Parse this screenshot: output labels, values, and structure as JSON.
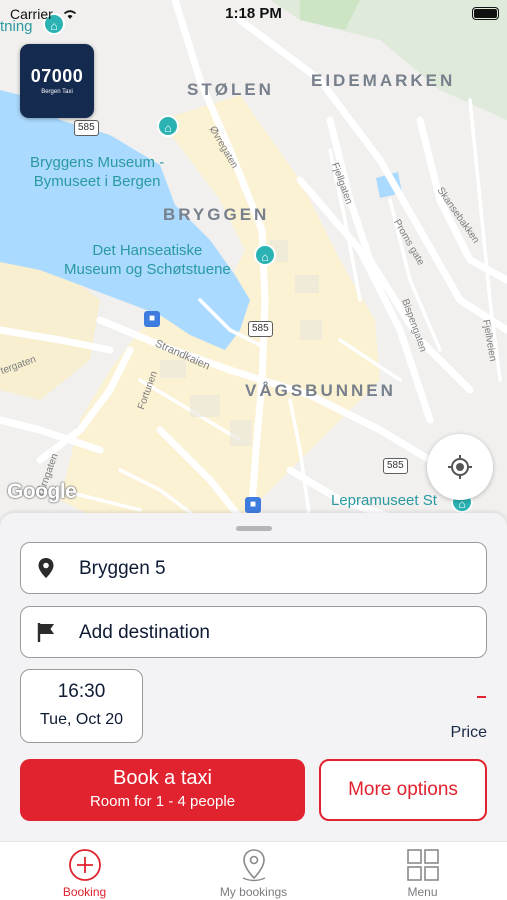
{
  "status_bar": {
    "carrier": "Carrier",
    "time": "1:18 PM"
  },
  "logo": {
    "number": "07000",
    "subtitle": "Bergen Taxi"
  },
  "map": {
    "districts": [
      "STØLEN",
      "EIDEMARKEN",
      "BRYGGEN",
      "VÅGSBUNNEN"
    ],
    "pois": [
      "Bryggens Museum -\nBymuseet i Bergen",
      "Det Hanseatiske\nMuseum og Schøtstuene",
      "Lepramuseet St",
      "tning"
    ],
    "streets": [
      "Øvregaten",
      "Strandkaien",
      "Fjellgaten",
      "Proms gate",
      "Skansebakken",
      "Fortunen",
      "Bispengaten",
      "Fjellveien",
      "tergaten",
      "Tårngaten"
    ],
    "route_shields": [
      "585",
      "585",
      "585"
    ],
    "attribution": "Google",
    "accent_water": "#aadaff",
    "accent_area": "#fbf2d3"
  },
  "panel": {
    "pickup": "Bryggen 5",
    "destination_placeholder": "Add destination",
    "time": "16:30",
    "date": "Tue, Oct 20",
    "price_value": "-",
    "price_label": "Price",
    "book_button": {
      "label": "Book a taxi",
      "sublabel": "Room for 1 - 4 people"
    },
    "more_options": "More options",
    "brand_color": "#e0232e"
  },
  "tabs": [
    {
      "label": "Booking",
      "icon": "plus-circle-icon",
      "active": true
    },
    {
      "label": "My bookings",
      "icon": "location-pin-icon",
      "active": false
    },
    {
      "label": "Menu",
      "icon": "grid-icon",
      "active": false
    }
  ]
}
